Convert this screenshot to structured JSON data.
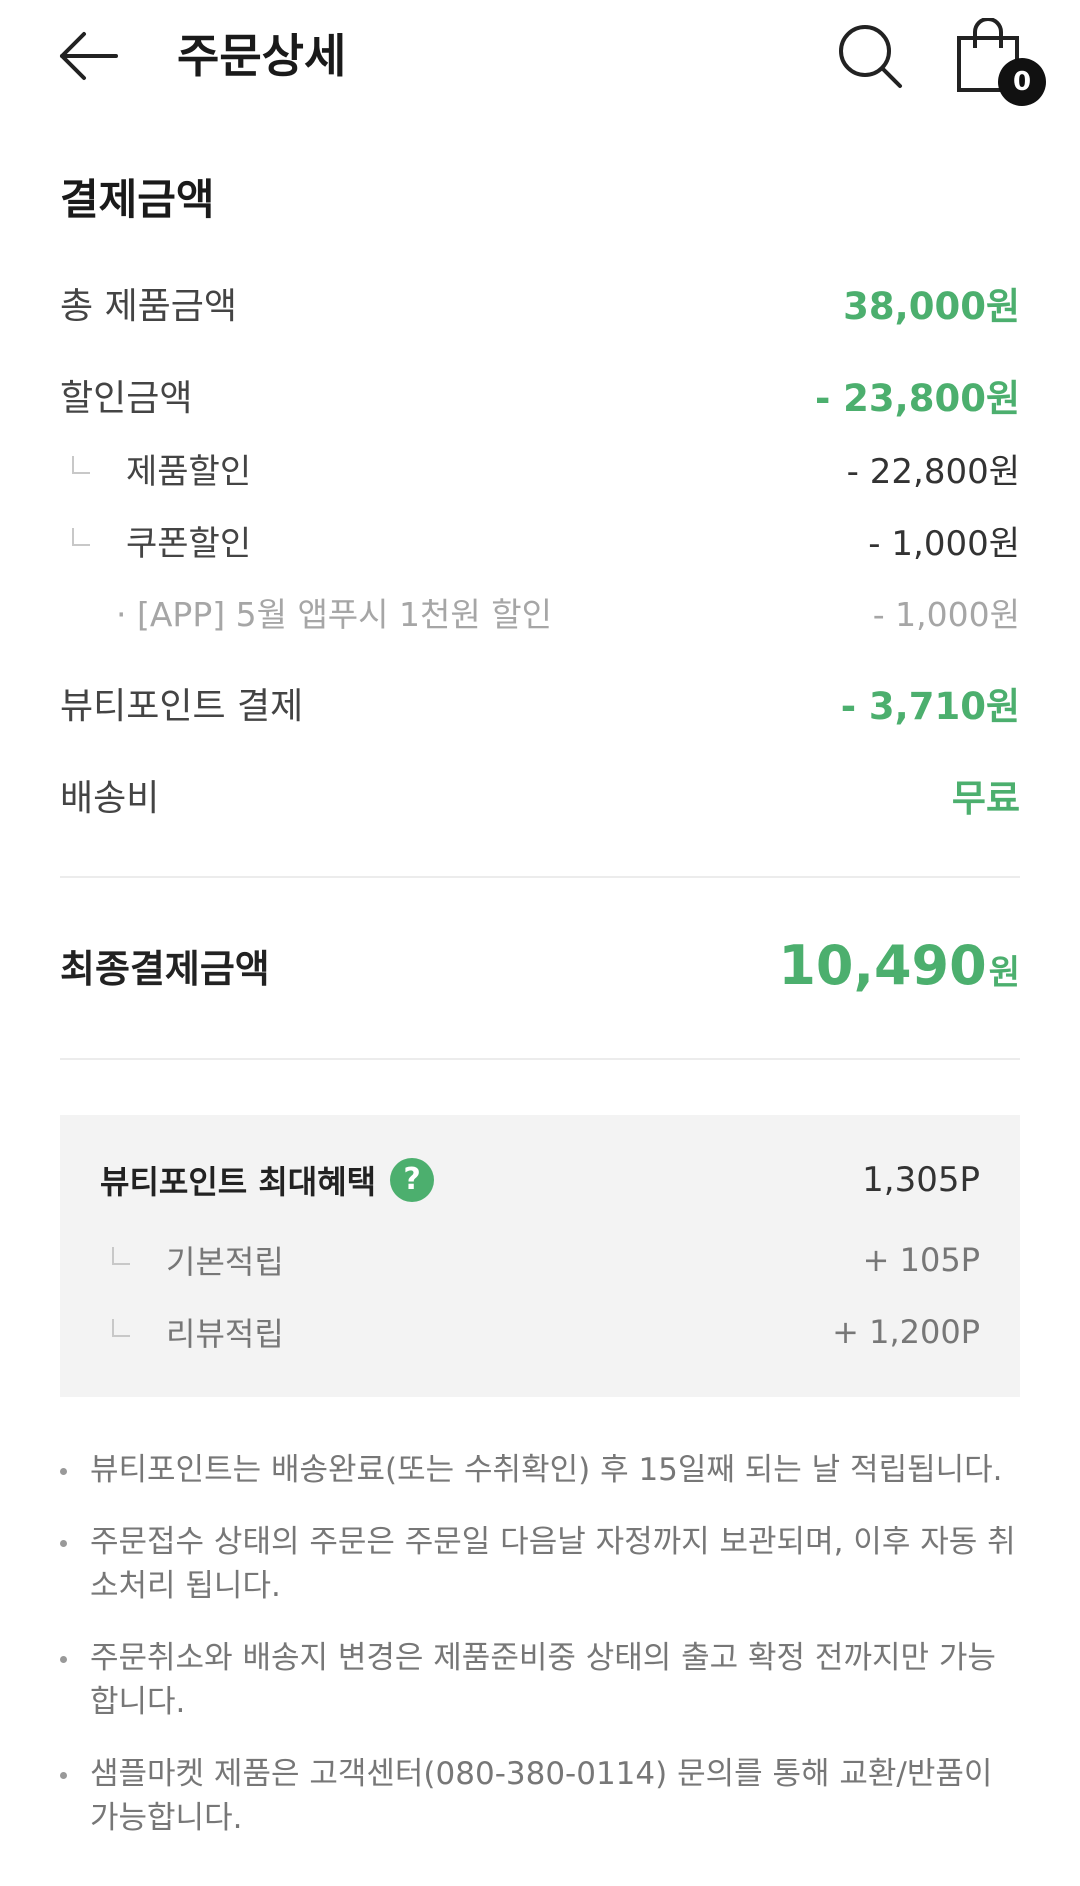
{
  "header": {
    "title": "주문상세",
    "back_icon": "arrow-left-icon",
    "search_icon": "search-icon",
    "cart_icon": "shopping-bag-icon",
    "cart_count": "0"
  },
  "payment": {
    "section_title": "결제금액",
    "total_product_label": "총 제품금액",
    "total_product_value": "38,000원",
    "discount_label": "할인금액",
    "discount_value": "- 23,800원",
    "product_discount_label": "제품할인",
    "product_discount_value": "- 22,800원",
    "coupon_discount_label": "쿠폰할인",
    "coupon_discount_value": "- 1,000원",
    "coupon_item_label": "· [APP] 5월 앱푸시 1천원 할인",
    "coupon_item_value": "- 1,000원",
    "beauty_point_label": "뷰티포인트 결제",
    "beauty_point_value": "- 3,710원",
    "shipping_label": "배송비",
    "shipping_value": "무료",
    "final_label": "최종결제금액",
    "final_amount": "10,490",
    "final_unit": "원"
  },
  "points": {
    "title": "뷰티포인트 최대혜택",
    "help_icon": "?",
    "total": "1,305P",
    "basic_label": "기본적립",
    "basic_value": "+ 105P",
    "review_label": "리뷰적립",
    "review_value": "+ 1,200P"
  },
  "notes": [
    "뷰티포인트는 배송완료(또는 수취확인) 후 15일째 되는 날 적립됩니다.",
    "주문접수 상태의 주문은 주문일 다음날 자정까지 보관되며, 이후 자동 취소처리 됩니다.",
    "주문취소와 배송지 변경은 제품준비중 상태의 출고 확정 전까지만 가능합니다.",
    "샘플마켓 제품은 고객센터(080-380-0114) 문의를 통해 교환/반품이 가능합니다."
  ],
  "colors": {
    "accent": "#4caf6e",
    "panel": "#f3f3f3"
  }
}
